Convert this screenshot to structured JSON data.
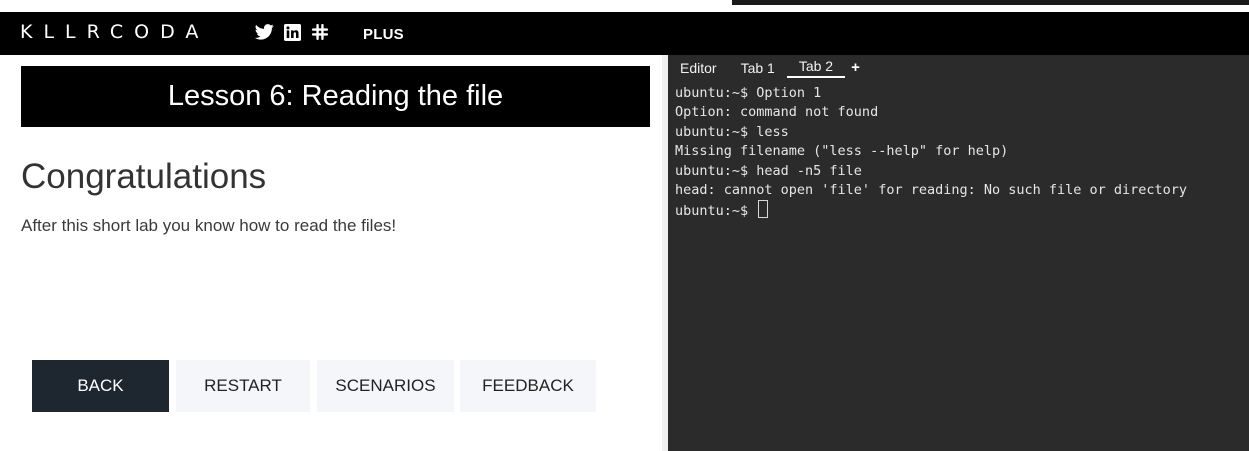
{
  "navbar": {
    "logo": "KLLRCODA",
    "social_icons": [
      "twitter-icon",
      "linkedin-icon",
      "slack-icon"
    ],
    "plus_label": "PLUS"
  },
  "lesson": {
    "title": "Lesson 6: Reading the file",
    "heading": "Congratulations",
    "body": "After this short lab you know how to read the files!",
    "buttons": {
      "back": "BACK",
      "restart": "RESTART",
      "scenarios": "SCENARIOS",
      "feedback": "FEEDBACK"
    }
  },
  "terminal": {
    "tabs": [
      {
        "label": "Editor",
        "active": false
      },
      {
        "label": "Tab 1",
        "active": false
      },
      {
        "label": "Tab 2",
        "active": true
      }
    ],
    "add_tab_label": "+",
    "lines": [
      "ubuntu:~$ Option 1",
      "Option: command not found",
      "ubuntu:~$ less",
      "Missing filename (\"less --help\" for help)",
      "ubuntu:~$ head -n5 file",
      "head: cannot open 'file' for reading: No such file or directory"
    ],
    "prompt": "ubuntu:~$ "
  },
  "colors": {
    "navbar_bg": "#000000",
    "terminal_bg": "#2b2b2b",
    "back_button_bg": "#1e2630",
    "secondary_button_bg": "#f4f6f9"
  }
}
